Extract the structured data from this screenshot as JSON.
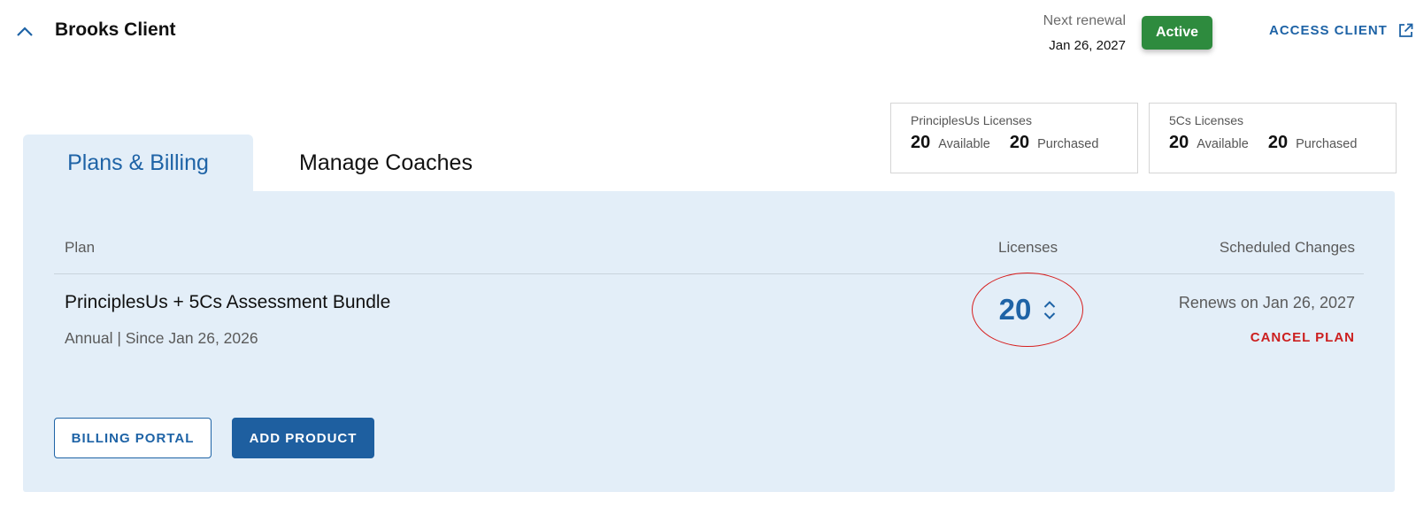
{
  "header": {
    "client_name": "Brooks Client",
    "next_renewal_label": "Next renewal",
    "next_renewal_date": "Jan 26, 2027",
    "status": "Active",
    "access_client_label": "ACCESS CLIENT"
  },
  "license_summary": [
    {
      "title": "PrinciplesUs Licenses",
      "available": "20",
      "available_label": "Available",
      "purchased": "20",
      "purchased_label": "Purchased"
    },
    {
      "title": "5Cs Licenses",
      "available": "20",
      "available_label": "Available",
      "purchased": "20",
      "purchased_label": "Purchased"
    }
  ],
  "tabs": [
    {
      "label": "Plans & Billing",
      "active": true
    },
    {
      "label": "Manage Coaches",
      "active": false
    }
  ],
  "plans_table": {
    "headers": {
      "plan": "Plan",
      "licenses": "Licenses",
      "scheduled_changes": "Scheduled Changes"
    },
    "rows": [
      {
        "name": "PrinciplesUs + 5Cs Assessment Bundle",
        "subtitle": "Annual | Since Jan 26, 2026",
        "licenses": "20",
        "renews": "Renews on Jan 26, 2027",
        "cancel_label": "CANCEL PLAN"
      }
    ]
  },
  "actions": {
    "billing_portal": "BILLING PORTAL",
    "add_product": "ADD PRODUCT"
  },
  "colors": {
    "accent": "#1e63a6",
    "active_badge": "#2e8b3e",
    "panel_bg": "#e3eef8",
    "danger": "#cc1f1f"
  },
  "icons": {
    "collapse": "chevron-up-icon",
    "access_client": "external-link-icon",
    "stepper_up": "chevron-up-icon",
    "stepper_down": "chevron-down-icon"
  }
}
